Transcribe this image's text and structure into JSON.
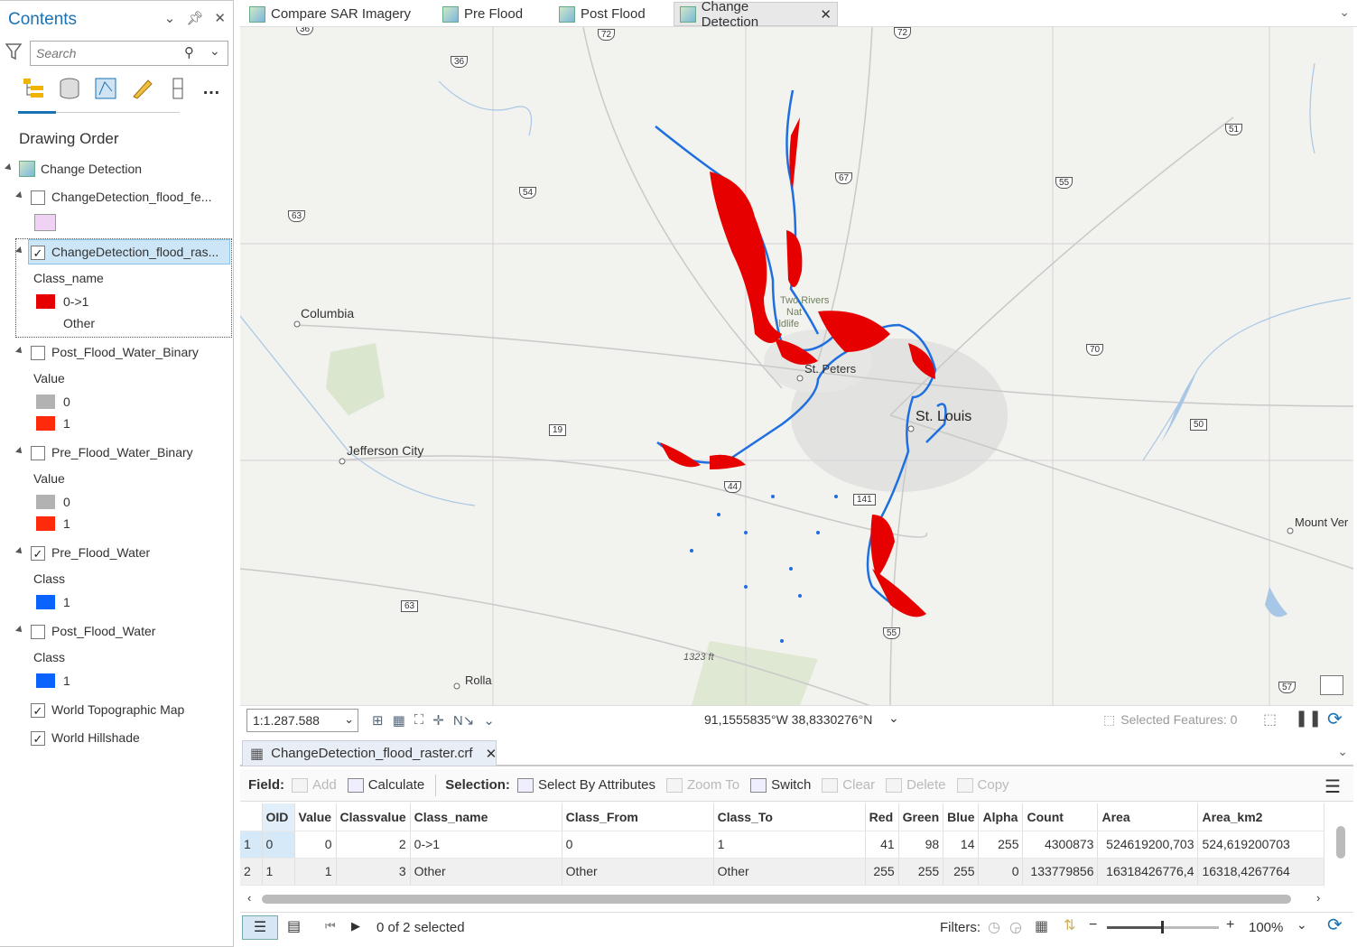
{
  "contents": {
    "title": "Contents",
    "search_placeholder": "Search",
    "drawing_order": "Drawing Order",
    "layers": [
      {
        "name": "Change Detection",
        "checked": null
      },
      {
        "name": "ChangeDetection_flood_fe...",
        "checked": false
      },
      {
        "name": "ChangeDetection_flood_ras...",
        "checked": true
      },
      {
        "name": "Post_Flood_Water_Binary",
        "checked": false
      },
      {
        "name": "Pre_Flood_Water_Binary",
        "checked": false
      },
      {
        "name": "Pre_Flood_Water",
        "checked": true
      },
      {
        "name": "Post_Flood_Water",
        "checked": false
      },
      {
        "name": "World Topographic Map",
        "checked": true
      },
      {
        "name": "World Hillshade",
        "checked": true
      }
    ],
    "legend": {
      "class_name_header": "Class_name",
      "class_a": "0->1",
      "class_b": "Other",
      "value_header": "Value",
      "v0": "0",
      "v1": "1",
      "class_header": "Class",
      "c1": "1"
    },
    "colors": {
      "red": "#e60000",
      "gray": "#b2b2b2",
      "orange_red": "#ff2a0a",
      "blue": "#0a62ff",
      "lilac": "#f0d2f5"
    }
  },
  "map_tabs": [
    "Compare SAR Imagery",
    "Pre Flood",
    "Post Flood",
    "Change Detection"
  ],
  "map_labels": {
    "columbia": "Columbia",
    "jefferson": "Jefferson City",
    "stpeters": "St. Peters",
    "stlouis": "St. Louis",
    "rolla": "Rolla",
    "mountver": "Mount Ver",
    "tworivers1": "Two Rivers",
    "tworivers2": "Nat",
    "tworivers3": "ildlife",
    "elev": "1323 ft",
    "shields": [
      "36",
      "72",
      "72",
      "36",
      "54",
      "67",
      "63",
      "51",
      "55",
      "70",
      "19",
      "50",
      "44",
      "141",
      "63",
      "55",
      "57"
    ]
  },
  "map_status": {
    "scale": "1:1.287.588",
    "coords": "91,1555835°W 38,8330276°N",
    "selected_features": "Selected Features: 0"
  },
  "table": {
    "tab_title": "ChangeDetection_flood_raster.crf",
    "field_label": "Field:",
    "add": "Add",
    "calculate": "Calculate",
    "selection_label": "Selection:",
    "select_by_attributes": "Select By Attributes",
    "zoom_to": "Zoom To",
    "switch": "Switch",
    "clear": "Clear",
    "delete": "Delete",
    "copy": "Copy",
    "columns": [
      "OID",
      "Value",
      "Classvalue",
      "Class_name",
      "Class_From",
      "Class_To",
      "Red",
      "Green",
      "Blue",
      "Alpha",
      "Count",
      "Area",
      "Area_km2"
    ],
    "rows": [
      [
        "0",
        "0",
        "2",
        "0->1",
        "0",
        "1",
        "41",
        "98",
        "14",
        "255",
        "4300873",
        "524619200,703",
        "524,619200703"
      ],
      [
        "1",
        "1",
        "3",
        "Other",
        "Other",
        "Other",
        "255",
        "255",
        "255",
        "0",
        "133779856",
        "16318426776,4",
        "16318,4267764"
      ]
    ],
    "row_numbers": [
      "1",
      "2"
    ],
    "selected_text": "0 of 2 selected",
    "filters_label": "Filters:",
    "zoom": "100%"
  }
}
